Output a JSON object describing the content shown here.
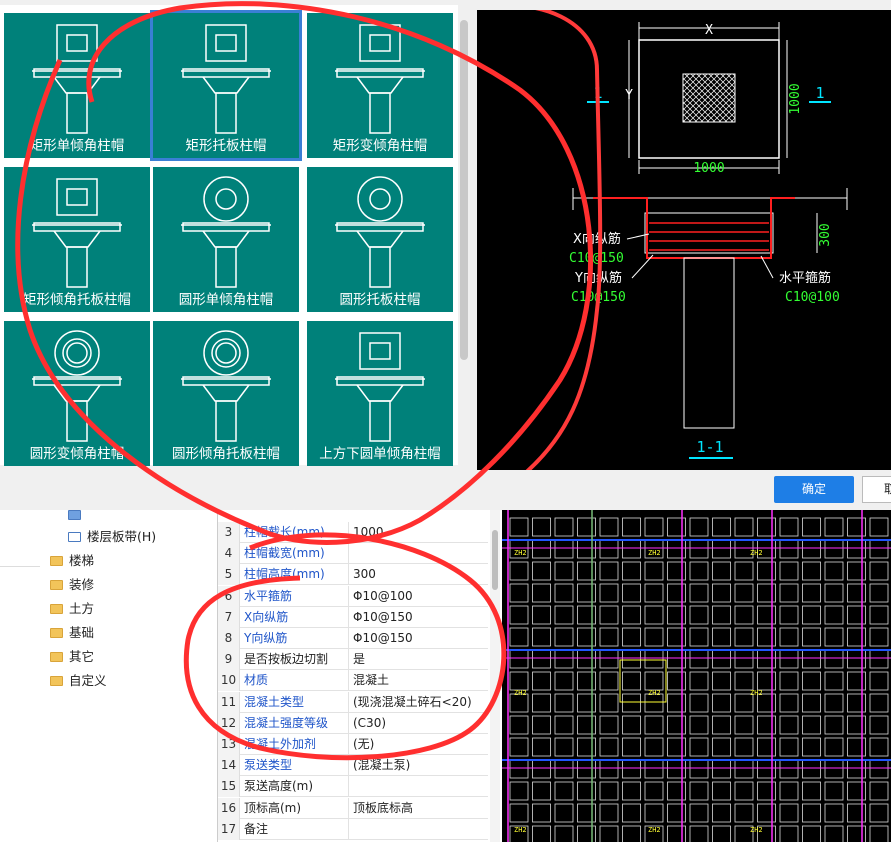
{
  "gallery": {
    "tiles": [
      {
        "label": "矩形单倾角柱帽"
      },
      {
        "label": "矩形托板柱帽"
      },
      {
        "label": "矩形变倾角柱帽"
      },
      {
        "label": "矩形倾角托板柱帽"
      },
      {
        "label": "圆形单倾角柱帽"
      },
      {
        "label": "圆形托板柱帽"
      },
      {
        "label": "圆形变倾角柱帽"
      },
      {
        "label": "圆形倾角托板柱帽"
      },
      {
        "label": "上方下圆单倾角柱帽"
      }
    ],
    "selected_index": 1
  },
  "preview": {
    "dim_x_label": "X",
    "dim_y_label": "Y",
    "dim_bottom": "1000",
    "dim_right": "1000",
    "section_mark": "1",
    "dim_height": "300",
    "x_rebar_label": "X向纵筋",
    "x_rebar_spec": "C10@150",
    "y_rebar_label": "Y向纵筋",
    "y_rebar_spec": "C10@150",
    "stirrup_label": "水平箍筋",
    "stirrup_spec": "C10@100",
    "section_title": "1-1"
  },
  "buttons": {
    "ok": "确定",
    "cancel": "取"
  },
  "tree": {
    "items": [
      {
        "label": "楼层板带(H)",
        "type": "item"
      },
      {
        "label": "楼梯",
        "type": "folder"
      },
      {
        "label": "装修",
        "type": "folder"
      },
      {
        "label": "土方",
        "type": "folder"
      },
      {
        "label": "基础",
        "type": "folder"
      },
      {
        "label": "其它",
        "type": "folder"
      },
      {
        "label": "自定义",
        "type": "folder"
      }
    ]
  },
  "props": {
    "rows": [
      {
        "num": "3",
        "name": "柱帽截长(mm)",
        "value": "1000",
        "blue": true
      },
      {
        "num": "4",
        "name": "柱帽截宽(mm)",
        "value": "",
        "blue": true
      },
      {
        "num": "5",
        "name": "柱帽高度(mm)",
        "value": "300",
        "blue": true
      },
      {
        "num": "6",
        "name": "水平箍筋",
        "value": "Φ10@100",
        "blue": true
      },
      {
        "num": "7",
        "name": "X向纵筋",
        "value": "Φ10@150",
        "blue": true
      },
      {
        "num": "8",
        "name": "Y向纵筋",
        "value": "Φ10@150",
        "blue": true
      },
      {
        "num": "9",
        "name": "是否按板边切割",
        "value": "是",
        "blue": false
      },
      {
        "num": "10",
        "name": "材质",
        "value": "混凝土",
        "blue": true
      },
      {
        "num": "11",
        "name": "混凝土类型",
        "value": "(现浇混凝土碎石<20)",
        "blue": true
      },
      {
        "num": "12",
        "name": "混凝土强度等级",
        "value": "(C30)",
        "blue": true
      },
      {
        "num": "13",
        "name": "混凝土外加剂",
        "value": "(无)",
        "blue": true
      },
      {
        "num": "14",
        "name": "泵送类型",
        "value": "(混凝土泵)",
        "blue": true
      },
      {
        "num": "15",
        "name": "泵送高度(m)",
        "value": "",
        "blue": false
      },
      {
        "num": "16",
        "name": "顶标高(m)",
        "value": "顶板底标高",
        "blue": false
      },
      {
        "num": "17",
        "name": "备注",
        "value": "",
        "blue": false
      }
    ]
  },
  "cad": {
    "label": "ZH2"
  },
  "colors": {
    "tile_bg": "#00817a",
    "annotation_red": "#ff2a2a",
    "cad_cyan": "#00e5ff",
    "cad_green": "#33ff33",
    "ok_blue": "#1e7ee6"
  }
}
